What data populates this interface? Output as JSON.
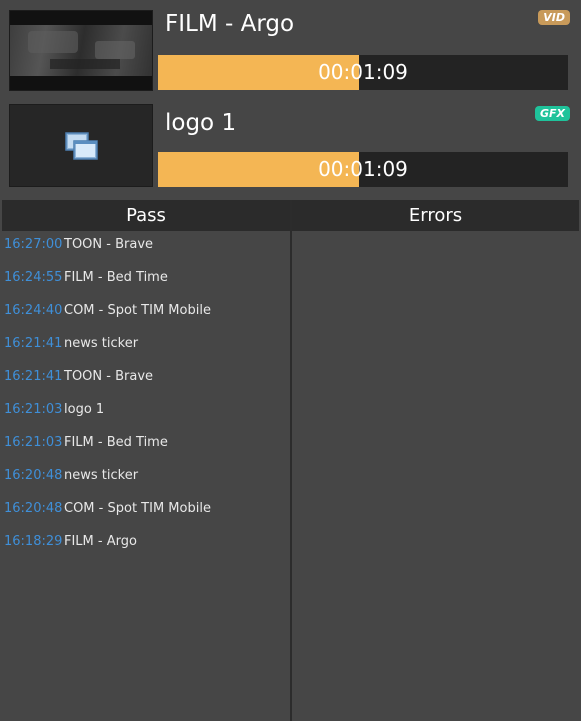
{
  "players": [
    {
      "title": "FILM - Argo",
      "badge": "VID",
      "badge_color": "#c89a5a",
      "time": "00:01:09",
      "progress_fraction": 0.49,
      "thumbnail": "film-frame"
    },
    {
      "title": "logo 1",
      "badge": "GFX",
      "badge_color": "#1fc39b",
      "time": "00:01:09",
      "progress_fraction": 0.49,
      "thumbnail": "graphics-icon"
    }
  ],
  "progress_color": "#f4b654",
  "pass": {
    "header": "Pass",
    "items": [
      {
        "time": "16:27:00",
        "name": "TOON - Brave"
      },
      {
        "time": "16:24:55",
        "name": "FILM - Bed Time"
      },
      {
        "time": "16:24:40",
        "name": "COM - Spot TIM Mobile"
      },
      {
        "time": "16:21:41",
        "name": "news ticker"
      },
      {
        "time": "16:21:41",
        "name": "TOON - Brave"
      },
      {
        "time": "16:21:03",
        "name": "logo 1"
      },
      {
        "time": "16:21:03",
        "name": "FILM - Bed Time"
      },
      {
        "time": "16:20:48",
        "name": "news ticker"
      },
      {
        "time": "16:20:48",
        "name": "COM - Spot TIM Mobile"
      },
      {
        "time": "16:18:29",
        "name": "FILM - Argo"
      }
    ]
  },
  "errors": {
    "header": "Errors",
    "items": []
  },
  "timestamp_color": "#3f8fd8"
}
